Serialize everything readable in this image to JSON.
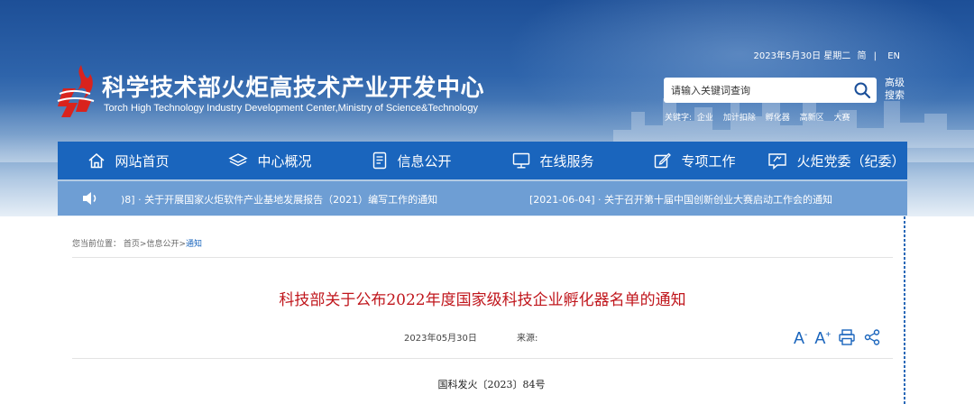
{
  "header": {
    "title": "科学技术部火炬高技术产业开发中心",
    "subtitle": "Torch High Technology Industry Development Center,Ministry of Science&Technology",
    "date": "2023年5月30日 星期二",
    "lang_simplified": "简",
    "lang_en": "EN",
    "colors": {
      "banner": "#1d4f97",
      "logo_red": "#d9231d"
    }
  },
  "search": {
    "placeholder": "请输入关键词查询",
    "advanced_label": "高级搜索",
    "keywords_label": "关键字:",
    "keywords": [
      "企业",
      "加计扣除",
      "孵化器",
      "高新区",
      "大赛"
    ]
  },
  "nav": {
    "color": "#1a65bd",
    "items": [
      {
        "label": "网站首页",
        "icon": "home-icon"
      },
      {
        "label": "中心概况",
        "icon": "layers-icon"
      },
      {
        "label": "信息公开",
        "icon": "document-icon"
      },
      {
        "label": "在线服务",
        "icon": "monitor-icon"
      },
      {
        "label": "专项工作",
        "icon": "edit-icon"
      },
      {
        "label": "火炬党委（纪委）",
        "icon": "party-icon"
      }
    ]
  },
  "ticker": {
    "items": [
      ")8] · 关于开展国家火炬软件产业基地发展报告（2021）编写工作的通知",
      "[2021-06-04] · 关于召开第十届中国创新创业大赛启动工作会的通知"
    ]
  },
  "breadcrumb": {
    "prefix": "您当前位置：",
    "items": [
      "首页",
      "信息公开",
      "通知"
    ]
  },
  "article": {
    "title": "科技部关于公布2022年度国家级科技企业孵化器名单的通知",
    "date": "2023年05月30日",
    "source_label": "来源:",
    "doc_number": "国科发火〔2023〕84号",
    "title_color": "#c0161c"
  },
  "tools": {
    "font_decrease": "A",
    "font_increase": "A"
  }
}
